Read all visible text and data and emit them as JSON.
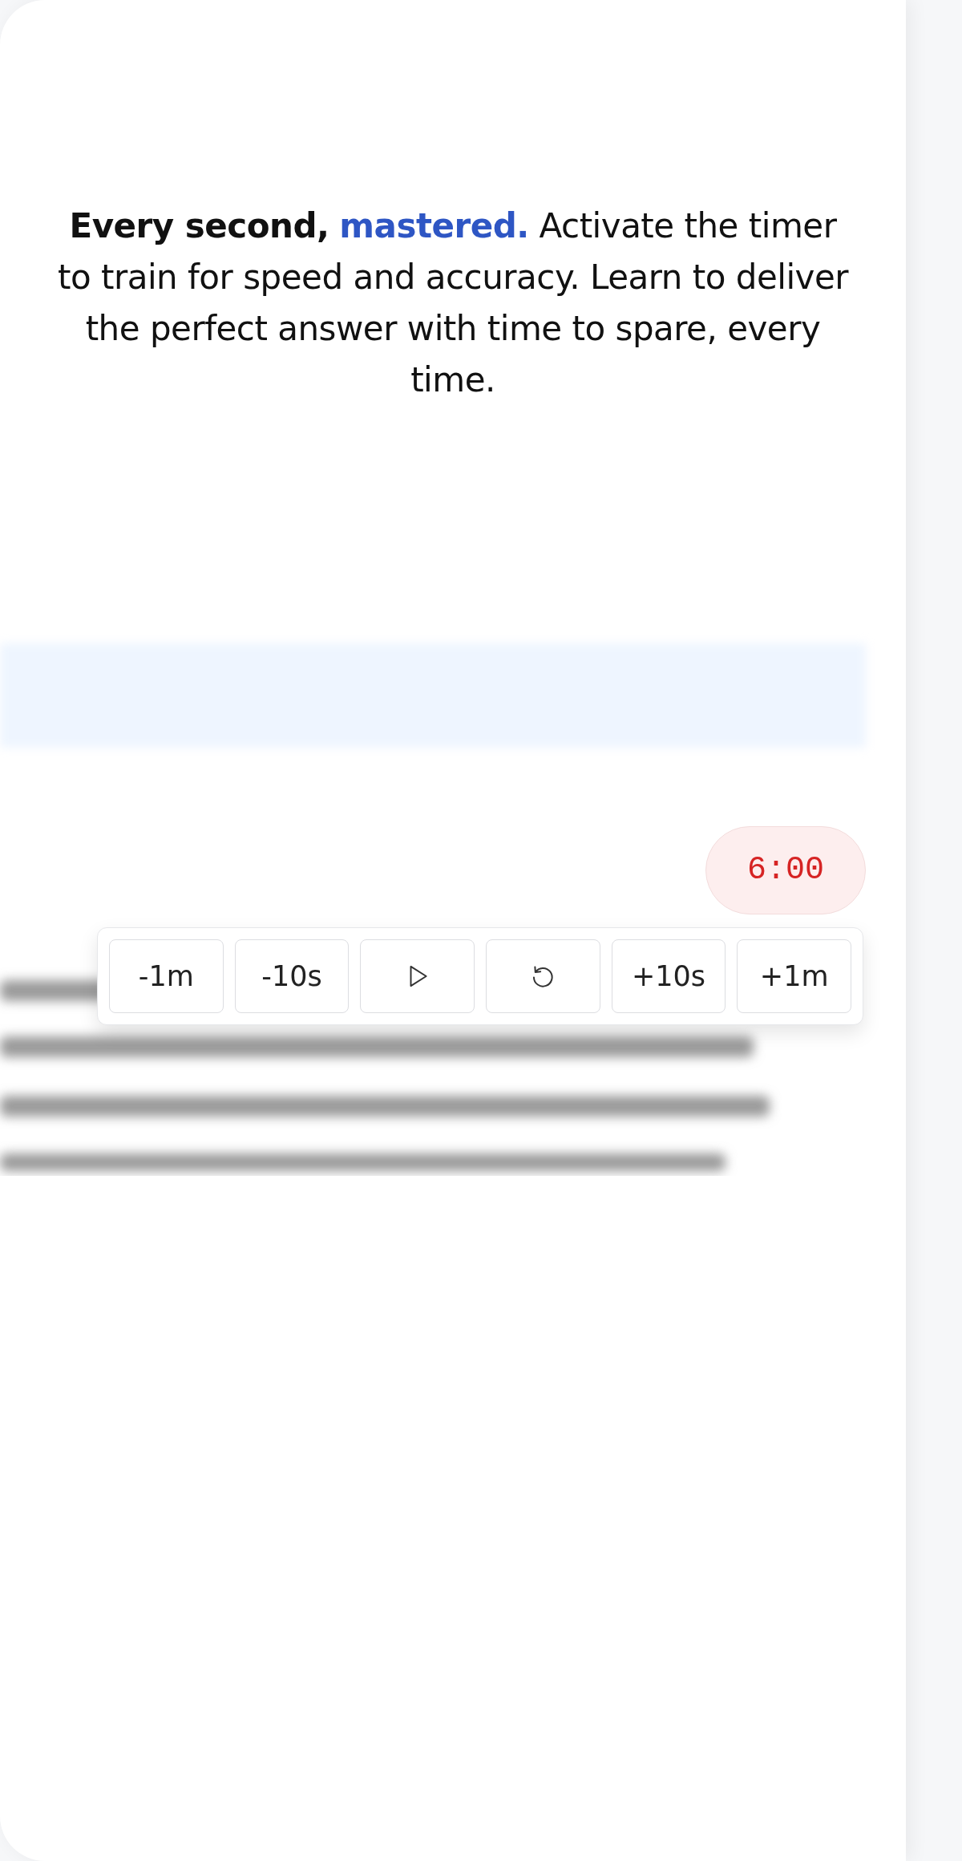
{
  "headline": {
    "lead": "Every second,",
    "highlight": "mastered.",
    "body": "Activate the timer to train for speed and accuracy. Learn to deliver the perfect answer with time to spare, every time."
  },
  "timer": {
    "display": "6:00"
  },
  "controls": [
    {
      "kind": "text",
      "label": "-1m"
    },
    {
      "kind": "text",
      "label": "-10s"
    },
    {
      "kind": "play"
    },
    {
      "kind": "reset"
    },
    {
      "kind": "text",
      "label": "+10s"
    },
    {
      "kind": "text",
      "label": "+1m"
    }
  ]
}
